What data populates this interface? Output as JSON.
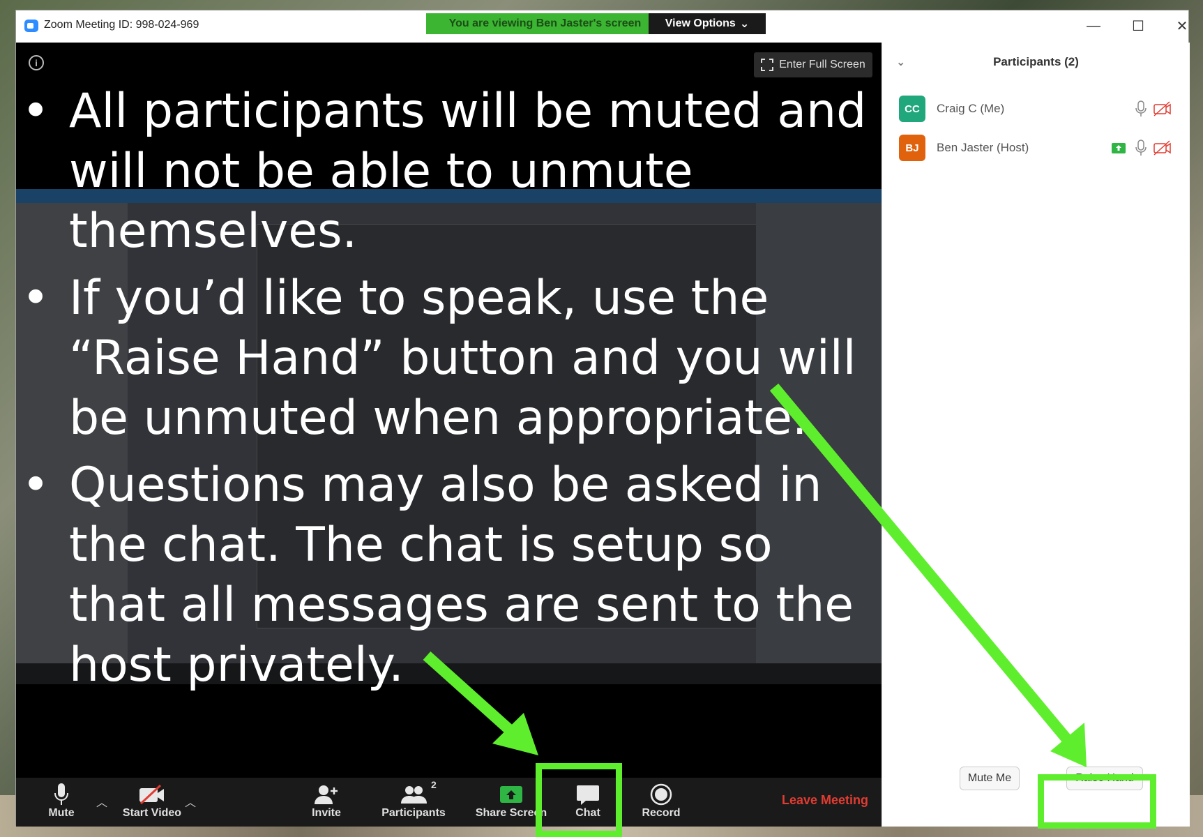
{
  "window": {
    "title": "Zoom Meeting ID: 998-024-969",
    "banner": "You are viewing Ben Jaster's screen",
    "view_options": "View Options",
    "minimize": "—",
    "maximize": "☐",
    "close": "✕"
  },
  "share": {
    "fullscreen_label": "Enter Full Screen",
    "info_icon": "i"
  },
  "slide": {
    "bullets": [
      "All participants will be muted and will not be able to unmute themselves.",
      "If you’d like to speak, use the “Raise Hand” button and you will be unmuted when appropriate.",
      "Questions may also be asked in the chat. The chat is setup so that all messages are sent to the host privately."
    ],
    "bullet_char": "•"
  },
  "toolbar": {
    "mute": "Mute",
    "start_video": "Start Video",
    "invite": "Invite",
    "participants": "Participants",
    "participants_count": "2",
    "share_screen": "Share Screen",
    "chat": "Chat",
    "record": "Record",
    "leave": "Leave Meeting"
  },
  "participants_panel": {
    "title": "Participants (2)",
    "list": [
      {
        "initials": "CC",
        "name": "Craig C (Me)",
        "avatar_color": "#20a77c"
      },
      {
        "initials": "BJ",
        "name": "Ben Jaster (Host)",
        "avatar_color": "#e0620d"
      }
    ],
    "mute_me": "Mute Me",
    "raise_hand": "Raise Hand"
  },
  "colors": {
    "highlight": "#5fee2d",
    "banner": "#3cb533",
    "leave": "#e03c31",
    "share_green": "#2fb544"
  }
}
